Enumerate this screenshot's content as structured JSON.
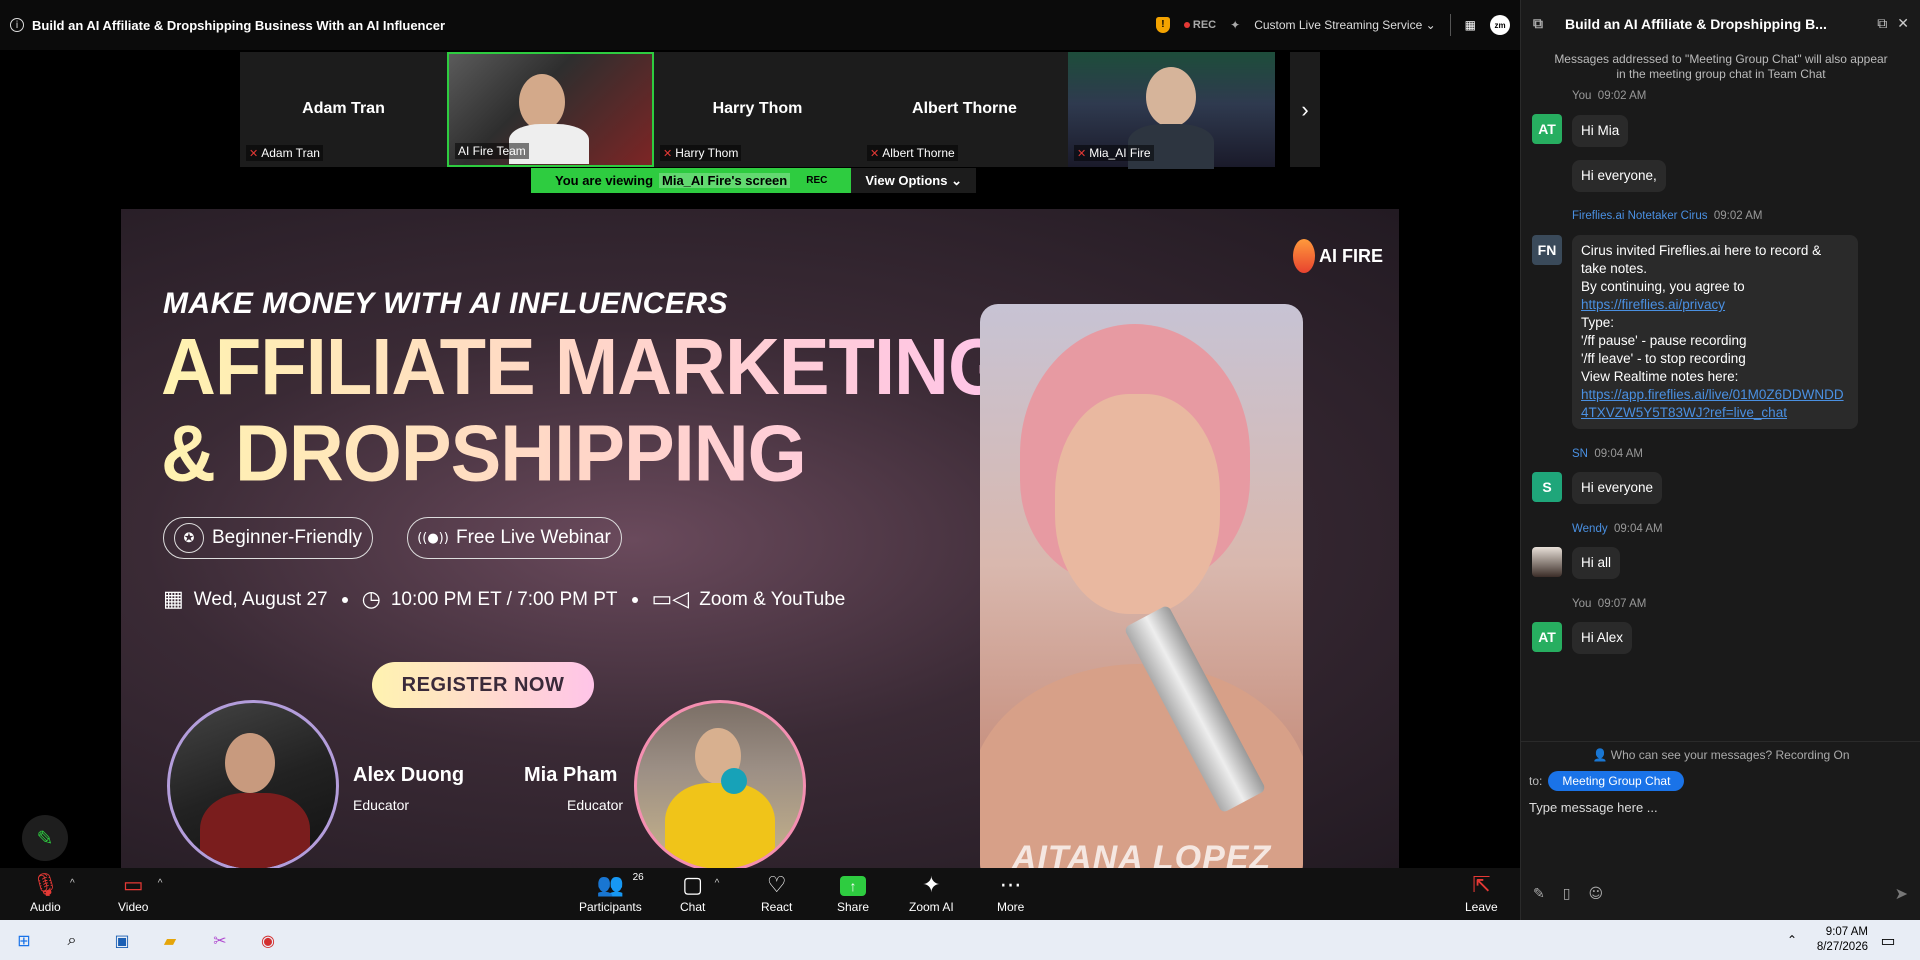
{
  "window": {
    "title": "Build an AI Affiliate & Dropshipping Business With an AI Influencer"
  },
  "topbar": {
    "rec": "REC",
    "streaming": "Custom Live Streaming Service",
    "zm": "zm"
  },
  "participants_strip": [
    {
      "big": "Adam Tran",
      "tag": "Adam Tran",
      "video": false
    },
    {
      "big": "",
      "tag": "AI Fire Team",
      "video": true
    },
    {
      "big": "Harry Thom",
      "tag": "Harry Thom",
      "video": false
    },
    {
      "big": "Albert Thorne",
      "tag": "Albert Thorne",
      "video": false
    },
    {
      "big": "",
      "tag": "Mia_AI Fire",
      "video": true
    }
  ],
  "viewing": {
    "prefix": "You are viewing",
    "who": "Mia_AI Fire's screen",
    "rec": "REC",
    "options": "View Options"
  },
  "slide": {
    "kicker": "MAKE MONEY WITH AI INFLUENCERS",
    "headline1": "AFFILIATE MARKETING",
    "headline2": "& DROPSHIPPING",
    "pill1": "Beginner-Friendly",
    "pill2": "Free Live Webinar",
    "date": "Wed, August 27",
    "time": "10:00 PM ET / 7:00 PM PT",
    "platform": "Zoom & YouTube",
    "register": "REGISTER NOW",
    "speaker1_name": "Alex Duong",
    "speaker1_role": "Educator",
    "speaker2_name": "Mia Pham",
    "speaker2_role": "Educator",
    "portrait_name": "AITANA LOPEZ",
    "logo": "AI FIRE"
  },
  "toolbar": {
    "audio": "Audio",
    "video": "Video",
    "participants": "Participants",
    "participants_count": "26",
    "chat": "Chat",
    "react": "React",
    "share": "Share",
    "zoom_ai": "Zoom AI",
    "more": "More",
    "leave": "Leave"
  },
  "chat": {
    "title": "Build an AI Affiliate & Dropshipping B...",
    "notice": "Messages addressed to \"Meeting Group Chat\" will also appear in the meeting group chat in Team Chat",
    "m1_meta": "You",
    "m1_time": "09:02 AM",
    "m1_av": "AT",
    "m1_text": "Hi Mia",
    "m1b_text": "Hi everyone,",
    "m2_name": "Fireflies.ai Notetaker Cirus",
    "m2_time": "09:02 AM",
    "m2_av": "FN",
    "m2_l1": "Cirus invited Fireflies.ai here to record & take notes.",
    "m2_l2": "By continuing, you agree to",
    "m2_link1": "https://fireflies.ai/privacy",
    "m2_l3": "Type:",
    "m2_l4": "'/ff pause' - pause recording",
    "m2_l5": "'/ff leave' - to stop recording",
    "m2_l6": "View Realtime notes here:",
    "m2_link2": "https://app.fireflies.ai/live/01M0Z6DDWNDD4TXVZW5Y5T83WJ?ref=live_chat",
    "m3_name": "SN",
    "m3_time": "09:04 AM",
    "m3_av": "S",
    "m3_text": "Hi everyone",
    "m4_name": "Wendy",
    "m4_time": "09:04 AM",
    "m4_text": "Hi all",
    "m5_meta": "You",
    "m5_time": "09:07 AM",
    "m5_av": "AT",
    "m5_text": "Hi Alex",
    "whocan": "Who can see your messages? Recording On",
    "to_label": "to:",
    "to_chip": "Meeting Group Chat",
    "placeholder": "Type message here ..."
  },
  "taskbar": {
    "time": "9:07 AM",
    "date": "8/27/2026"
  }
}
